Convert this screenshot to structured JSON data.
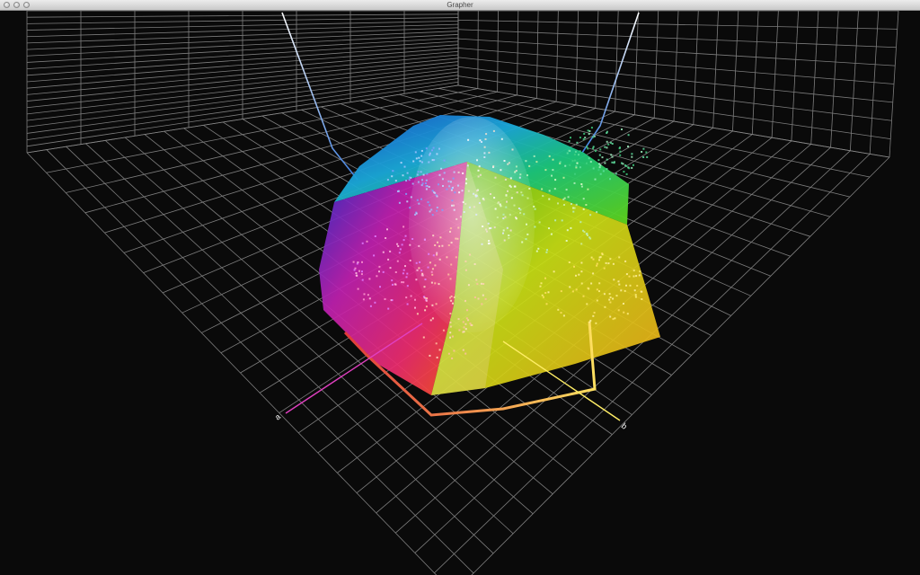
{
  "window": {
    "title": "Grapher"
  },
  "axes": {
    "a_label": "a",
    "b_label": "b"
  },
  "colors": {
    "background": "#0a0a0a",
    "grid": "#8a8a8a",
    "axis_vertical": "#7fc7ff",
    "axis_a": "#e040c0",
    "axis_b": "#ffee66"
  }
}
